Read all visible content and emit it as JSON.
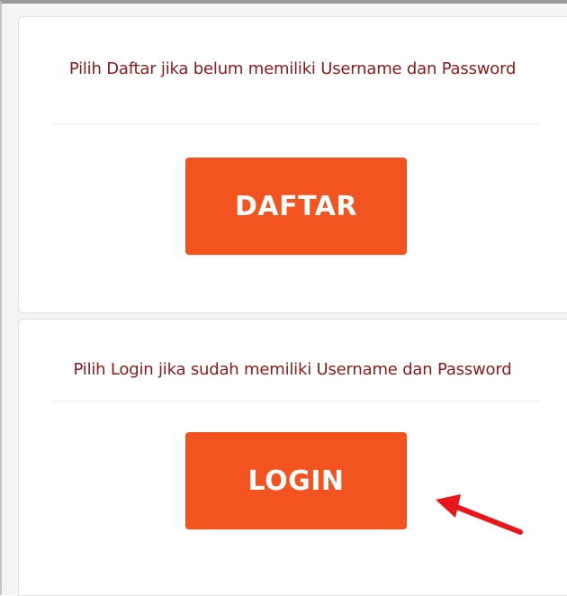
{
  "register_panel": {
    "description": "Pilih Daftar jika belum memiliki Username dan Password",
    "button_label": "DAFTAR"
  },
  "login_panel": {
    "description": "Pilih Login jika sudah memiliki Username dan Password",
    "button_label": "LOGIN"
  },
  "annotation": {
    "arrow_color": "#e8161b",
    "arrow_icon": "red-arrow-pointing-left-up"
  },
  "colors": {
    "button_bg": "#f2531f",
    "button_text": "#ffffff",
    "description_text": "#8b1a1a"
  }
}
